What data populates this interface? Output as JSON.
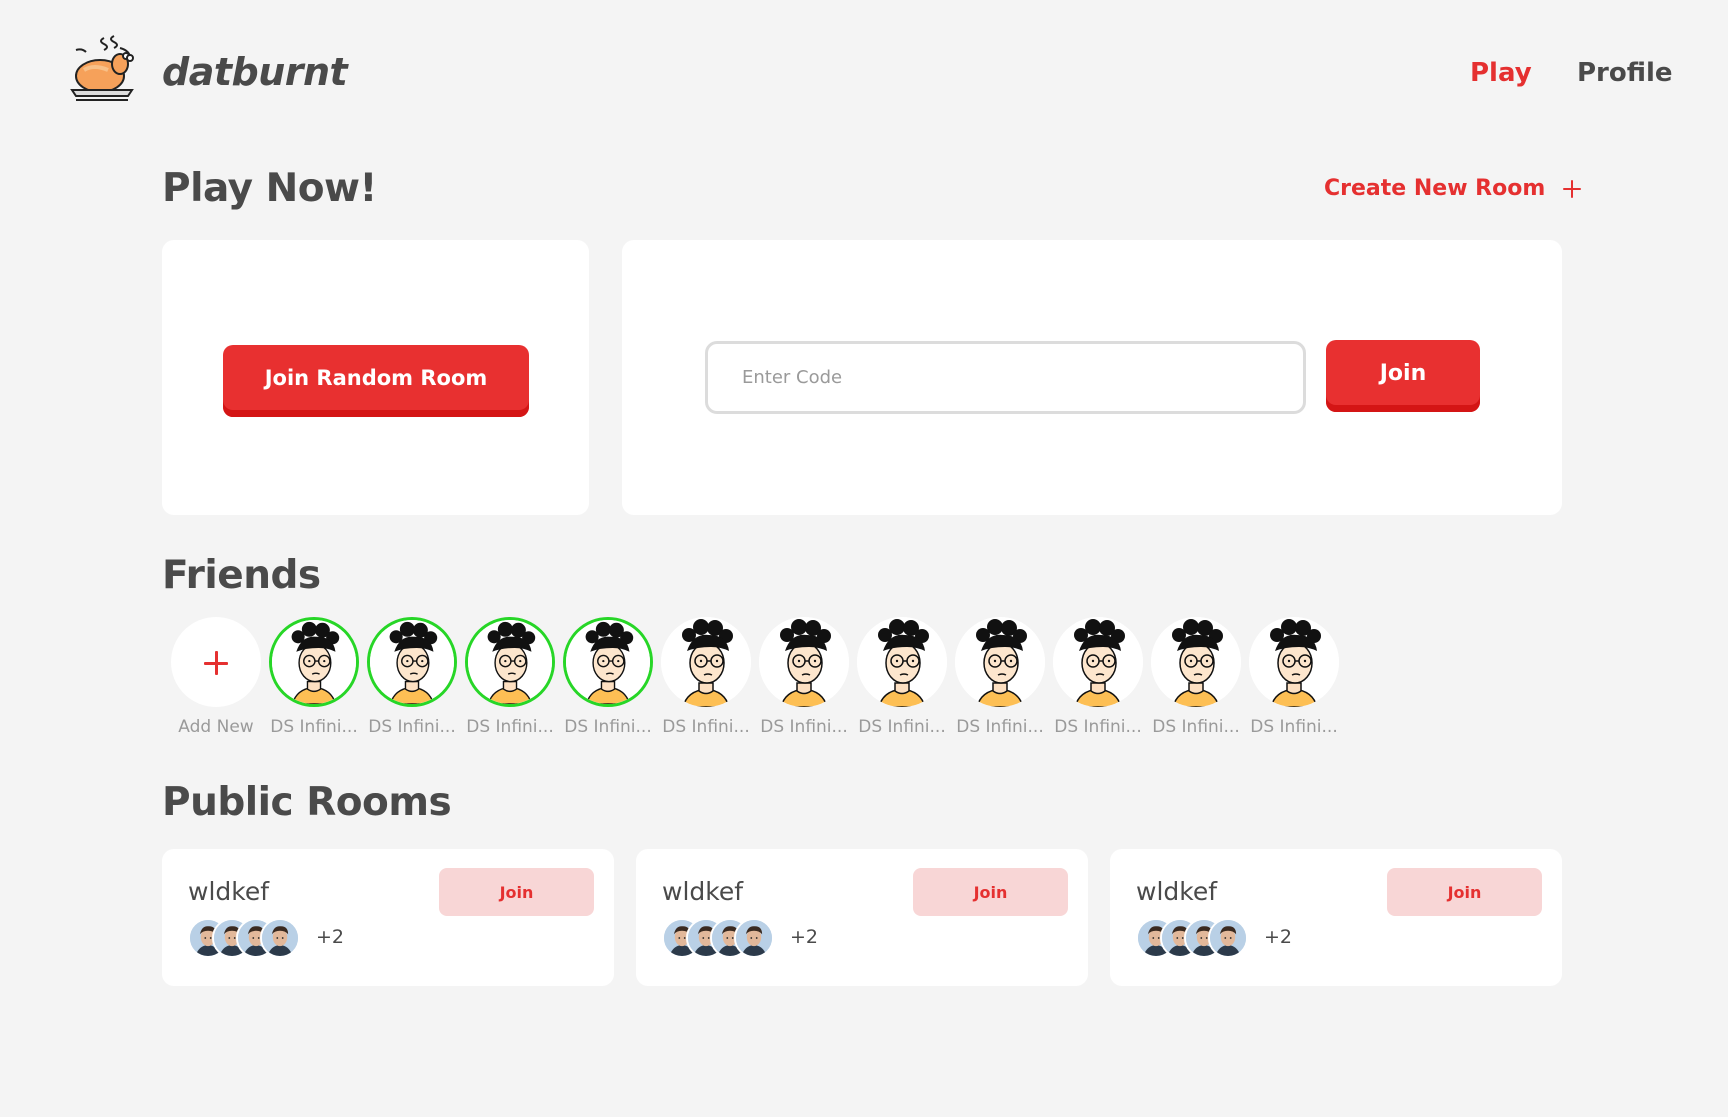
{
  "header": {
    "brand": "datburnt",
    "logo_icon": "roast-turkey-icon",
    "nav": [
      {
        "label": "Play",
        "active": true
      },
      {
        "label": "Profile",
        "active": false
      }
    ]
  },
  "play_now": {
    "title": "Play Now!",
    "create_room_label": "Create New Room",
    "create_room_icon": "plus-icon",
    "random_button": "Join Random Room",
    "code_placeholder": "Enter Code",
    "join_button": "Join"
  },
  "friends": {
    "title": "Friends",
    "add_label": "Add New",
    "items": [
      {
        "name": "DS Infini...",
        "online": true
      },
      {
        "name": "DS Infini...",
        "online": true
      },
      {
        "name": "DS Infini...",
        "online": true
      },
      {
        "name": "DS Infini...",
        "online": true
      },
      {
        "name": "DS Infini...",
        "online": false
      },
      {
        "name": "DS Infini...",
        "online": false
      },
      {
        "name": "DS Infini...",
        "online": false
      },
      {
        "name": "DS Infini...",
        "online": false
      },
      {
        "name": "DS Infini...",
        "online": false
      },
      {
        "name": "DS Infini...",
        "online": false
      },
      {
        "name": "DS Infini...",
        "online": false
      }
    ]
  },
  "public_rooms": {
    "title": "Public Rooms",
    "rooms": [
      {
        "name": "wldkef",
        "join_label": "Join",
        "extra_members": "+2"
      },
      {
        "name": "wldkef",
        "join_label": "Join",
        "extra_members": "+2"
      },
      {
        "name": "wldkef",
        "join_label": "Join",
        "extra_members": "+2"
      }
    ]
  },
  "colors": {
    "accent": "#e83030",
    "online": "#27d627",
    "background": "#f4f4f4",
    "text": "#4a4a4a"
  }
}
